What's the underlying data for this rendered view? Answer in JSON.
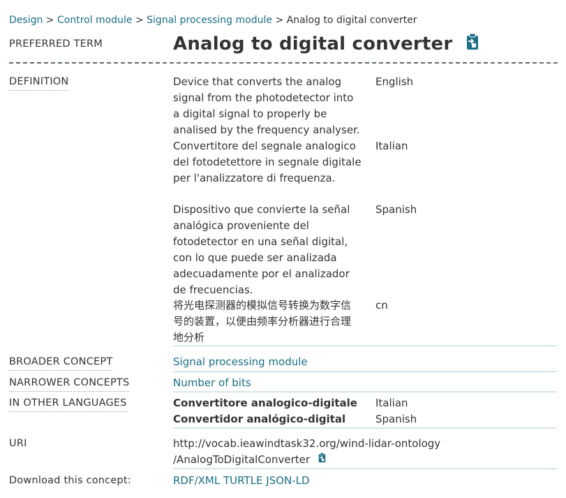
{
  "breadcrumb": {
    "items": [
      "Design",
      "Control module",
      "Signal processing module"
    ],
    "current": "Analog to digital converter",
    "separator": ">"
  },
  "preferred_term": {
    "label": "PREFERRED TERM",
    "value": "Analog to digital converter",
    "icon": "copy-to-clipboard-icon"
  },
  "definition": {
    "label": "DEFINITION",
    "entries": [
      {
        "text": "Device that converts the analog signal from the photodetector into a digital signal to properly be analised by the frequency analyser.",
        "lang": "English"
      },
      {
        "text": "Convertitore del segnale analogico del fotodetettore in segnale digitale per l'analizzatore di frequenza.",
        "lang": "Italian"
      },
      {
        "text": "Dispositivo que convierte la señal analógica proveniente del fotodetector en una señal digital, con lo que puede ser analizada adecuadamente por el analizador de frecuencias.",
        "lang": "Spanish"
      },
      {
        "text": "将光电探测器的模拟信号转换为数字信号的装置，以便由频率分析器进行合理地分析",
        "lang": "cn"
      }
    ]
  },
  "broader": {
    "label": "BROADER CONCEPT",
    "value": "Signal processing module"
  },
  "narrower": {
    "label": "NARROWER CONCEPTS",
    "value": "Number of bits"
  },
  "other_languages": {
    "label": "IN OTHER LANGUAGES",
    "entries": [
      {
        "term": "Convertitore analogico-digitale",
        "lang": "Italian"
      },
      {
        "term": "Convertidor analógico-digital",
        "lang": "Spanish"
      }
    ]
  },
  "uri": {
    "label": "URI",
    "line1": "http://vocab.ieawindtask32.org/wind-lidar-ontology",
    "line2": "/AnalogToDigitalConverter",
    "icon": "copy-to-clipboard-icon"
  },
  "download": {
    "label": "Download this concept:",
    "formats": [
      "RDF/XML",
      "TURTLE",
      "JSON-LD"
    ]
  },
  "colors": {
    "link": "#1a6e86",
    "text": "#333333",
    "rule": "#d5e6e6",
    "dashed": "#5a6a70"
  }
}
